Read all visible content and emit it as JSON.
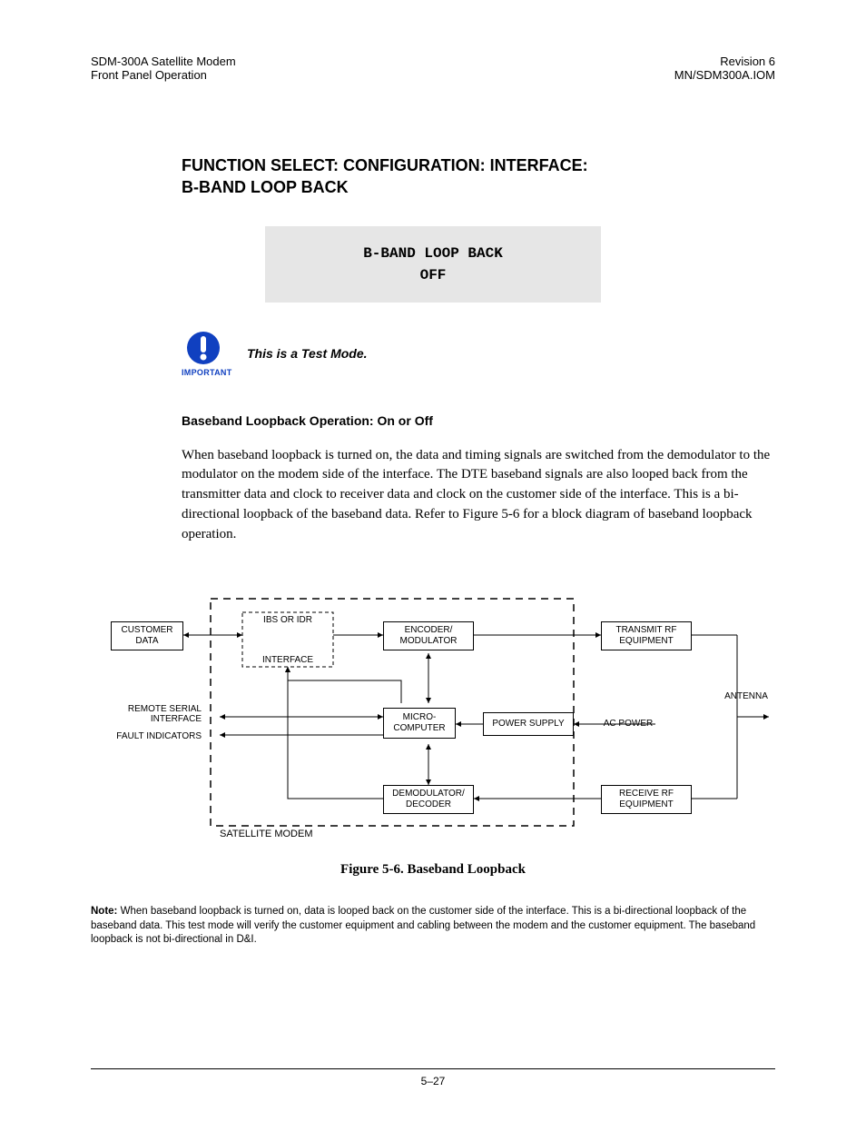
{
  "header": {
    "left1": "SDM-300A Satellite Modem",
    "left2": "Front Panel Operation",
    "right1": "Revision 6",
    "right2": "MN/SDM300A.IOM"
  },
  "section_title_l1": "FUNCTION SELECT: CONFIGURATION: INTERFACE:",
  "section_title_l2": "B-BAND LOOP BACK",
  "lcd_line1": "B-BAND LOOP BACK",
  "lcd_line2": "OFF",
  "important_label": "IMPORTANT",
  "test_mode_text": "This is a Test Mode.",
  "sub_heading": "Baseband Loopback Operation: On or Off",
  "body_text": "When baseband loopback is turned on, the data and timing signals are switched from the demodulator to the modulator on the modem side of the interface. The DTE baseband signals are also looped back from the transmitter data and clock to receiver data and clock on the customer side of the interface. This is a bi-directional loopback of the baseband data. Refer to Figure 5-6 for a block diagram of baseband loopback operation.",
  "diagram": {
    "customer_data": "CUSTOMER\nDATA",
    "ibs_or_idr": "IBS OR IDR",
    "interface": "INTERFACE",
    "encoder_mod": "ENCODER/\nMODULATOR",
    "transmit_rf": "TRANSMIT RF\nEQUIPMENT",
    "remote_serial": "REMOTE SERIAL\nINTERFACE",
    "fault_ind": "FAULT INDICATORS",
    "micro": "MICRO-\nCOMPUTER",
    "power_supply": "POWER SUPPLY",
    "ac_power": "AC POWER",
    "antenna": "ANTENNA",
    "demod_dec": "DEMODULATOR/\nDECODER",
    "receive_rf": "RECEIVE RF\nEQUIPMENT",
    "sat_modem": "SATELLITE MODEM"
  },
  "figure_caption": "Figure 5-6.  Baseband Loopback",
  "note_label": "Note:",
  "note_text": " When baseband loopback is turned on, data is looped back on the customer side of the interface. This is a bi-directional loopback of the baseband data. This test mode will verify the customer equipment and cabling between the modem and the customer equipment. The baseband loopback is not bi-directional in D&I.",
  "page_number": "5–27"
}
